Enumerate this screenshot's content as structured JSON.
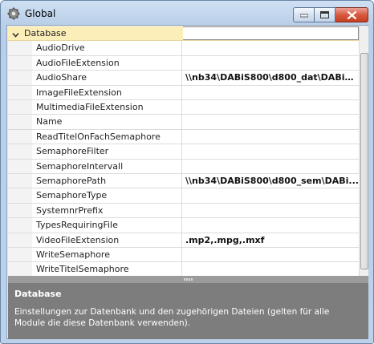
{
  "window": {
    "title": "Global",
    "colors": {
      "category_bg": "#fbeeb8",
      "description_bg": "#7d7d7d",
      "close_red": "#d9593f"
    }
  },
  "grid": {
    "category": "Database",
    "properties": [
      {
        "name": "AudioDrive",
        "value": ""
      },
      {
        "name": "AudioFileExtension",
        "value": ""
      },
      {
        "name": "AudioShare",
        "value": "\\\\nb34\\DABiS800\\d800_dat\\DABiS..."
      },
      {
        "name": "ImageFileExtension",
        "value": ""
      },
      {
        "name": "MultimediaFileExtension",
        "value": ""
      },
      {
        "name": "Name",
        "value": ""
      },
      {
        "name": "ReadTitelOnFachSemaphore",
        "value": ""
      },
      {
        "name": "SemaphoreFilter",
        "value": ""
      },
      {
        "name": "SemaphoreIntervall",
        "value": ""
      },
      {
        "name": "SemaphorePath",
        "value": "\\\\nb34\\DABiS800\\d800_sem\\DABi..."
      },
      {
        "name": "SemaphoreType",
        "value": ""
      },
      {
        "name": "SystemnrPrefix",
        "value": ""
      },
      {
        "name": "TypesRequiringFile",
        "value": ""
      },
      {
        "name": "VideoFileExtension",
        "value": ".mp2,.mpg,.mxf"
      },
      {
        "name": "WriteSemaphore",
        "value": ""
      },
      {
        "name": "WriteTitelSemaphore",
        "value": ""
      }
    ]
  },
  "description": {
    "title": "Database",
    "text": "Einstellungen zur Datenbank und den zugehörigen Dateien (gelten für alle Module die diese Datenbank verwenden)."
  }
}
